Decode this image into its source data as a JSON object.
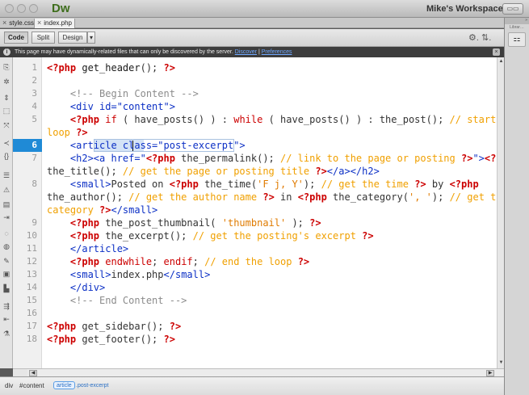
{
  "window": {
    "app_title": "Dw",
    "workspace_label": "Mike's Workspace",
    "workspace_caret": "▾",
    "panel_toggle": "▭▭"
  },
  "tabs": [
    {
      "label": "style.css",
      "close": "×",
      "active": false
    },
    {
      "label": "index.php",
      "close": "×",
      "active": true
    }
  ],
  "toolbar": {
    "code_label": "Code",
    "split_label": "Split",
    "design_label": "Design",
    "design_caret": "▾",
    "right_icons": "⚙. ⇅."
  },
  "infobar": {
    "icon": "i",
    "message": "This page may have dynamically-related files that can only be discovered by the server.",
    "discover_link": "Discover",
    "separator": "|",
    "preferences_link": "Preferences",
    "close": "×"
  },
  "right_panel": {
    "header": "»",
    "label": "Librar…",
    "icon": "⚏"
  },
  "left_tools": [
    {
      "name": "open-documents-icon",
      "glyph": "⎘"
    },
    {
      "name": "show-code-navigator-icon",
      "glyph": "✲"
    },
    {
      "name": "collapse-full-tag-icon",
      "glyph": "⇕"
    },
    {
      "name": "collapse-selection-icon",
      "glyph": "⬚"
    },
    {
      "name": "expand-all-icon",
      "glyph": "⤧"
    },
    {
      "name": "select-parent-tag-icon",
      "glyph": "≺"
    },
    {
      "name": "balance-braces-icon",
      "glyph": "{}"
    },
    {
      "name": "line-numbers-icon",
      "glyph": "☰"
    },
    {
      "name": "highlight-invalid-code-icon",
      "glyph": "⚠"
    },
    {
      "name": "syntax-coloring-icon",
      "glyph": "▤"
    },
    {
      "name": "auto-indent-icon",
      "glyph": "⇥"
    },
    {
      "name": "apply-comment-icon",
      "glyph": "◌"
    },
    {
      "name": "remove-comment-icon",
      "glyph": "◍"
    },
    {
      "name": "wrap-tag-icon",
      "glyph": "✎"
    },
    {
      "name": "recent-snippets-icon",
      "glyph": "▣"
    },
    {
      "name": "move-css-icon",
      "glyph": "▙"
    },
    {
      "name": "indent-code-icon",
      "glyph": "⇶"
    },
    {
      "name": "outdent-code-icon",
      "glyph": "⇤"
    },
    {
      "name": "format-source-code-icon",
      "glyph": "⚗"
    }
  ],
  "code_lines": [
    {
      "n": "1",
      "html": "<span class=\"t-php\">&lt;?php</span> <span class=\"t-dark\">get_header</span>(); <span class=\"t-php\">?&gt;</span>"
    },
    {
      "n": "2",
      "html": ""
    },
    {
      "n": "3",
      "html": "    <span class=\"t-comment-html\">&lt;!-- Begin Content --&gt;</span>"
    },
    {
      "n": "4",
      "html": "    <span class=\"t-html\">&lt;div id=\"content\"&gt;</span>"
    },
    {
      "n": "5",
      "html": "    <span class=\"t-php\">&lt;?php</span> <span class=\"t-kw\">if</span> ( have_posts() ) : <span class=\"t-kw\">while</span> ( have_posts() ) : the_post(); <span class=\"t-cmt\">// start the</span>"
    },
    {
      "n": "",
      "html": "<span class=\"t-cmt\">loop</span> <span class=\"t-php\">?&gt;</span>",
      "cont": true
    },
    {
      "n": "6",
      "html": "    <span class=\"t-html\">&lt;article class=\"post-excerpt\"&gt;</span>",
      "current": true
    },
    {
      "n": "7",
      "html": "    <span class=\"t-html\">&lt;h2&gt;&lt;a href=\"</span><span class=\"t-php\">&lt;?php</span> the_permalink(); <span class=\"t-cmt\">// link to the page or posting</span> <span class=\"t-php\">?&gt;</span><span class=\"t-html\">\"&gt;</span><span class=\"t-php\">&lt;?php</span>"
    },
    {
      "n": "",
      "html": "the_title(); <span class=\"t-cmt\">// get the page or posting title</span> <span class=\"t-php\">?&gt;</span><span class=\"t-html\">&lt;/a&gt;&lt;/h2&gt;</span>",
      "cont": true
    },
    {
      "n": "8",
      "html": "    <span class=\"t-html\">&lt;small&gt;</span>Posted on <span class=\"t-php\">&lt;?php</span> the_time(<span class=\"t-str\">'F j, Y'</span>); <span class=\"t-cmt\">// get the time</span> <span class=\"t-php\">?&gt;</span> by <span class=\"t-php\">&lt;?php</span>"
    },
    {
      "n": "",
      "html": "the_author(); <span class=\"t-cmt\">// get the author name</span> <span class=\"t-php\">?&gt;</span> in <span class=\"t-php\">&lt;?php</span> the_category(<span class=\"t-str\">', '</span>); <span class=\"t-cmt\">// get the</span>",
      "cont": true
    },
    {
      "n": "",
      "html": "<span class=\"t-cmt\">category</span> <span class=\"t-php\">?&gt;</span><span class=\"t-html\">&lt;/small&gt;</span>",
      "cont": true
    },
    {
      "n": "9",
      "html": "    <span class=\"t-php\">&lt;?php</span> the_post_thumbnail( <span class=\"t-str\">'thumbnail'</span> ); <span class=\"t-php\">?&gt;</span>"
    },
    {
      "n": "10",
      "html": "    <span class=\"t-php\">&lt;?php</span> the_excerpt(); <span class=\"t-cmt\">// get the posting's excerpt</span> <span class=\"t-php\">?&gt;</span>"
    },
    {
      "n": "11",
      "html": "    <span class=\"t-html\">&lt;/article&gt;</span>"
    },
    {
      "n": "12",
      "html": "    <span class=\"t-php\">&lt;?php</span> <span class=\"t-kw\">endwhile</span>; <span class=\"t-kw\">endif</span>; <span class=\"t-cmt\">// end the loop</span> <span class=\"t-php\">?&gt;</span>"
    },
    {
      "n": "13",
      "html": "    <span class=\"t-html\">&lt;small&gt;</span>index.php<span class=\"t-html\">&lt;/small&gt;</span>"
    },
    {
      "n": "14",
      "html": "    <span class=\"t-html\">&lt;/div&gt;</span>"
    },
    {
      "n": "15",
      "html": "    <span class=\"t-comment-html\">&lt;!-- End Content --&gt;</span>"
    },
    {
      "n": "16",
      "html": ""
    },
    {
      "n": "17",
      "html": "<span class=\"t-php\">&lt;?php</span> get_sidebar(); <span class=\"t-php\">?&gt;</span>"
    },
    {
      "n": "18",
      "html": "<span class=\"t-php\">&lt;?php</span> get_footer(); <span class=\"t-php\">?&gt;</span>"
    }
  ],
  "scrollbars": {
    "up": "▲",
    "down": "▼",
    "left": "◀",
    "right": "▶"
  },
  "status": {
    "tag1": "div",
    "tag2": "#content",
    "tag3": "article",
    "tag4": ".post-excerpt"
  },
  "colors": {
    "app_brand": "#3e6e1c",
    "php_delim": "#cc0000",
    "html_tag": "#0b2fc5",
    "comment": "#f0a000",
    "string": "#e07b00",
    "current_line": "#1f8ad6"
  }
}
